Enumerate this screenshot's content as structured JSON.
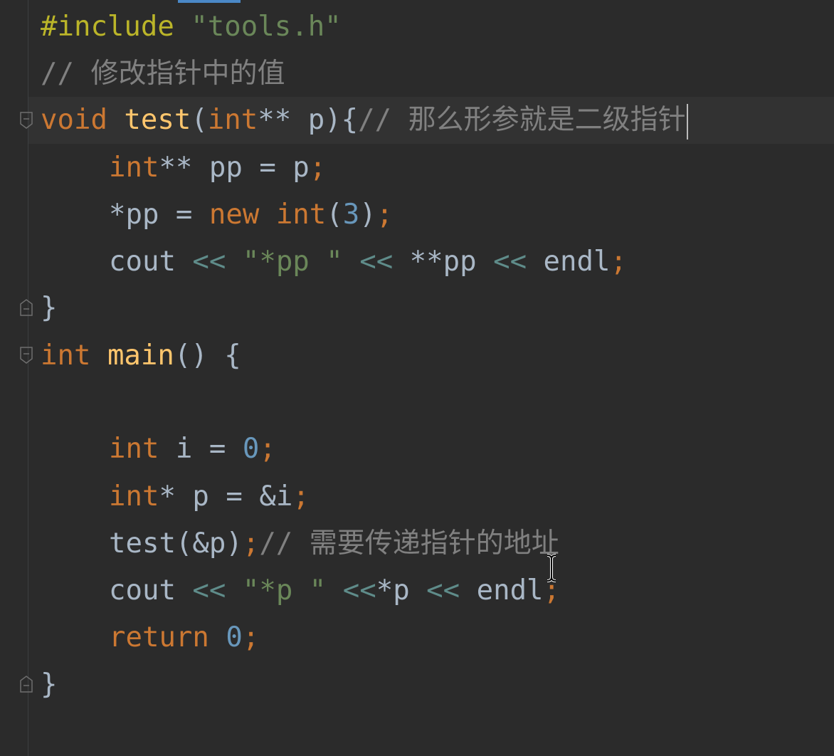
{
  "code": {
    "line1": {
      "directive": "#include",
      "file": "\"tools.h\""
    },
    "line2": {
      "comment": "// 修改指针中的值"
    },
    "line3": {
      "kw_void": "void",
      "fn_name": "test",
      "open_paren": "(",
      "kw_int": "int",
      "param": "** p",
      "close": "){",
      "comment": "// 那么形参就是二级指针"
    },
    "line4": {
      "kw_int": "int",
      "rest": "** pp = p",
      "semi": ";"
    },
    "line5": {
      "lhs": "*pp = ",
      "kw_new": "new",
      "space": " ",
      "kw_int": "int",
      "open": "(",
      "num": "3",
      "close": ")",
      "semi": ";"
    },
    "line6": {
      "cout": "cout ",
      "op1": "<<",
      "space1": " ",
      "str": "\"*pp \"",
      "space2": " ",
      "op2": "<<",
      "deref": " **pp ",
      "op3": "<<",
      "endl": " endl",
      "semi": ";"
    },
    "line7": {
      "brace": "}"
    },
    "line8": {
      "kw_int": "int",
      "space": " ",
      "fn_name": "main",
      "rest": "() {"
    },
    "line10": {
      "kw_int": "int",
      "rest": " i = ",
      "num": "0",
      "semi": ";"
    },
    "line11": {
      "kw_int": "int",
      "rest": "* p = &i",
      "semi": ";"
    },
    "line12": {
      "call": "test(&p)",
      "semi": ";",
      "comment": "// 需要传递指针的地址"
    },
    "line13": {
      "cout": "cout ",
      "op1": "<<",
      "space1": " ",
      "str": "\"*p \"",
      "space2": " ",
      "op2": "<<",
      "deref": "*p ",
      "op3": "<<",
      "endl": " endl",
      "semi": ";"
    },
    "line14": {
      "kw_return": "return",
      "space": " ",
      "num": "0",
      "semi": ";"
    },
    "line15": {
      "brace": "}"
    }
  },
  "icons": [
    "fold-close-icon",
    "fold-end-icon",
    "text-cursor-icon"
  ],
  "colors": {
    "background": "#2b2b2b",
    "keyword": "#cc7832",
    "string": "#6a8759",
    "function": "#ffc66d",
    "number": "#6897bb",
    "comment": "#808080",
    "directive": "#bbb529",
    "identifier": "#a9b7c6"
  }
}
